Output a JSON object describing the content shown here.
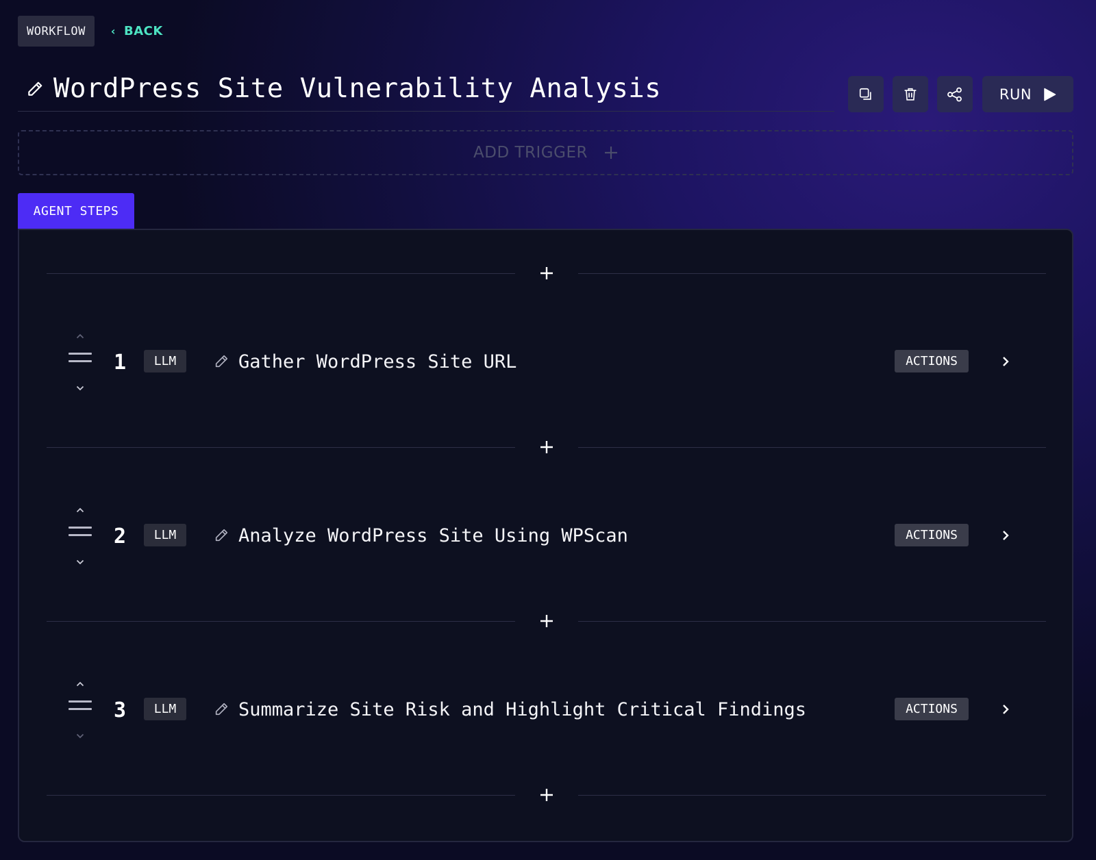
{
  "header": {
    "section_badge": "WORKFLOW",
    "back_label": "BACK",
    "title": "WordPress Site Vulnerability Analysis",
    "run_label": "RUN"
  },
  "trigger": {
    "label": "ADD TRIGGER"
  },
  "tabs": [
    {
      "label": "AGENT STEPS",
      "active": true
    }
  ],
  "steps": [
    {
      "number": "1",
      "type": "LLM",
      "name": "Gather WordPress Site URL",
      "actions_label": "ACTIONS"
    },
    {
      "number": "2",
      "type": "LLM",
      "name": "Analyze WordPress Site Using WPScan",
      "actions_label": "ACTIONS"
    },
    {
      "number": "3",
      "type": "LLM",
      "name": "Summarize Site Risk and Highlight Critical Findings",
      "actions_label": "ACTIONS"
    }
  ],
  "icons": {
    "title": "pencil-icon",
    "toolbar": [
      "copy-icon",
      "trash-icon",
      "share-icon"
    ],
    "run": "play-icon"
  },
  "colors": {
    "accent": "#4d2cf5",
    "back_link": "#4de3c2",
    "button_bg": "#2a2a55",
    "panel_bg": "#0d1020"
  }
}
